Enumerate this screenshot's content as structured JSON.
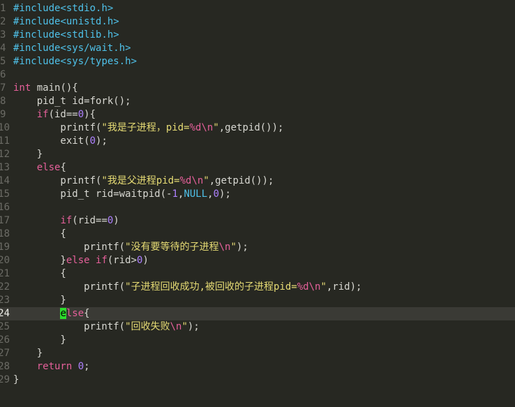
{
  "editor": {
    "current_line_index": 23,
    "cursor": {
      "line_index": 23,
      "char": "e"
    },
    "lines": [
      {
        "num": "1",
        "tokens": [
          [
            "pre",
            "#include"
          ],
          [
            "pre",
            "<stdio.h>"
          ]
        ]
      },
      {
        "num": "2",
        "tokens": [
          [
            "pre",
            "#include"
          ],
          [
            "pre",
            "<unistd.h>"
          ]
        ]
      },
      {
        "num": "3",
        "tokens": [
          [
            "pre",
            "#include"
          ],
          [
            "pre",
            "<stdlib.h>"
          ]
        ]
      },
      {
        "num": "4",
        "tokens": [
          [
            "pre",
            "#include"
          ],
          [
            "pre",
            "<sys/wait.h>"
          ]
        ]
      },
      {
        "num": "5",
        "tokens": [
          [
            "pre",
            "#include"
          ],
          [
            "pre",
            "<sys/types.h>"
          ]
        ]
      },
      {
        "num": "6",
        "tokens": []
      },
      {
        "num": "7",
        "tokens": [
          [
            "ty",
            "int"
          ],
          [
            "pl",
            " main(){"
          ]
        ]
      },
      {
        "num": "8",
        "tokens": [
          [
            "pl",
            "    pid_t id=fork();"
          ]
        ]
      },
      {
        "num": "9",
        "tokens": [
          [
            "pl",
            "    "
          ],
          [
            "kw",
            "if"
          ],
          [
            "pl",
            "(id=="
          ],
          [
            "num",
            "0"
          ],
          [
            "pl",
            "){"
          ]
        ]
      },
      {
        "num": "10",
        "tokens": [
          [
            "pl",
            "        printf("
          ],
          [
            "str",
            "\"我是子进程，pid="
          ],
          [
            "fmt",
            "%d"
          ],
          [
            "esc",
            "\\n"
          ],
          [
            "str",
            "\""
          ],
          [
            "pl",
            ",getpid());"
          ]
        ]
      },
      {
        "num": "11",
        "tokens": [
          [
            "pl",
            "        exit("
          ],
          [
            "num",
            "0"
          ],
          [
            "pl",
            ");"
          ]
        ]
      },
      {
        "num": "12",
        "tokens": [
          [
            "pl",
            "    }"
          ]
        ]
      },
      {
        "num": "13",
        "tokens": [
          [
            "pl",
            "    "
          ],
          [
            "kw",
            "else"
          ],
          [
            "pl",
            "{"
          ]
        ]
      },
      {
        "num": "14",
        "tokens": [
          [
            "pl",
            "        printf("
          ],
          [
            "str",
            "\"我是父进程pid="
          ],
          [
            "fmt",
            "%d"
          ],
          [
            "esc",
            "\\n"
          ],
          [
            "str",
            "\""
          ],
          [
            "pl",
            ",getpid());"
          ]
        ]
      },
      {
        "num": "15",
        "tokens": [
          [
            "pl",
            "        pid_t rid=waitpid(-"
          ],
          [
            "num",
            "1"
          ],
          [
            "pl",
            ","
          ],
          [
            "cst",
            "NULL"
          ],
          [
            "pl",
            ","
          ],
          [
            "num",
            "0"
          ],
          [
            "pl",
            ");"
          ]
        ]
      },
      {
        "num": "16",
        "tokens": []
      },
      {
        "num": "17",
        "tokens": [
          [
            "pl",
            "        "
          ],
          [
            "kw",
            "if"
          ],
          [
            "pl",
            "(rid=="
          ],
          [
            "num",
            "0"
          ],
          [
            "pl",
            ")"
          ]
        ]
      },
      {
        "num": "18",
        "tokens": [
          [
            "pl",
            "        {"
          ]
        ]
      },
      {
        "num": "19",
        "tokens": [
          [
            "pl",
            "            printf("
          ],
          [
            "str",
            "\"没有要等待的子进程"
          ],
          [
            "esc",
            "\\n"
          ],
          [
            "str",
            "\""
          ],
          [
            "pl",
            ");"
          ]
        ]
      },
      {
        "num": "20",
        "tokens": [
          [
            "pl",
            "        }"
          ],
          [
            "kw",
            "else"
          ],
          [
            "pl",
            " "
          ],
          [
            "kw",
            "if"
          ],
          [
            "pl",
            "(rid>"
          ],
          [
            "num",
            "0"
          ],
          [
            "pl",
            ")"
          ]
        ]
      },
      {
        "num": "21",
        "tokens": [
          [
            "pl",
            "        {"
          ]
        ]
      },
      {
        "num": "22",
        "tokens": [
          [
            "pl",
            "            printf("
          ],
          [
            "str",
            "\"子进程回收成功,被回收的子进程pid="
          ],
          [
            "fmt",
            "%d"
          ],
          [
            "esc",
            "\\n"
          ],
          [
            "str",
            "\""
          ],
          [
            "pl",
            ",rid);"
          ]
        ]
      },
      {
        "num": "23",
        "tokens": [
          [
            "pl",
            "        }"
          ]
        ]
      },
      {
        "num": "24",
        "tokens": [
          [
            "pl",
            "        "
          ],
          [
            "cursor",
            "e"
          ],
          [
            "kw",
            "lse"
          ],
          [
            "pl",
            "{"
          ]
        ]
      },
      {
        "num": "25",
        "tokens": [
          [
            "pl",
            "            printf("
          ],
          [
            "str",
            "\"回收失败"
          ],
          [
            "esc",
            "\\n"
          ],
          [
            "str",
            "\""
          ],
          [
            "pl",
            ");"
          ]
        ]
      },
      {
        "num": "26",
        "tokens": [
          [
            "pl",
            "        }"
          ]
        ]
      },
      {
        "num": "27",
        "tokens": [
          [
            "pl",
            "    }"
          ]
        ]
      },
      {
        "num": "28",
        "tokens": [
          [
            "pl",
            "    "
          ],
          [
            "kw",
            "return"
          ],
          [
            "pl",
            " "
          ],
          [
            "num",
            "0"
          ],
          [
            "pl",
            ";"
          ]
        ]
      },
      {
        "num": "29",
        "tokens": [
          [
            "pl",
            "}"
          ]
        ]
      }
    ]
  }
}
